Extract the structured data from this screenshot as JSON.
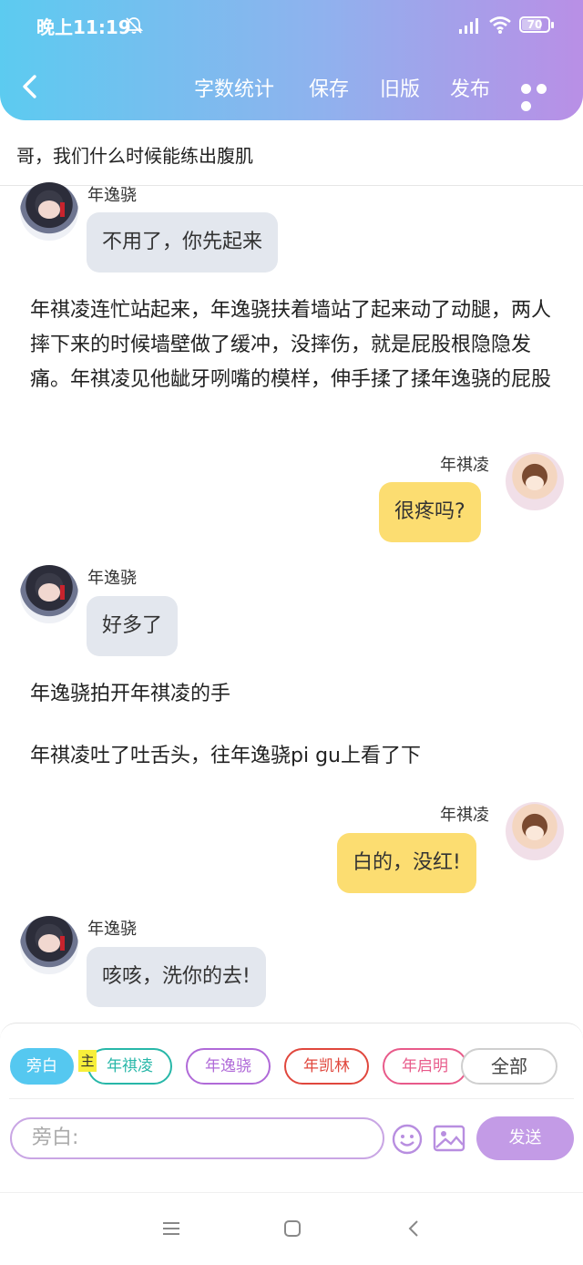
{
  "status_bar": {
    "time": "晚上11:19",
    "battery": "70"
  },
  "header": {
    "actions": [
      "字数统计",
      "保存",
      "旧版",
      "发布"
    ]
  },
  "chapter_title": "哥，我们什么时候能练出腹肌",
  "messages": [
    {
      "type": "left",
      "name": "年逸骁",
      "text": "不用了，你先起来"
    },
    {
      "type": "narration",
      "text": "年祺凌连忙站起来，年逸骁扶着墙站了起来动了动腿，两人摔下来的时候墙壁做了缓冲，没摔伤，就是屁股根隐隐发痛。年祺凌见他龇牙咧嘴的模样，伸手揉了揉年逸骁的屁股"
    },
    {
      "type": "right",
      "name": "年祺凌",
      "text": "很疼吗?"
    },
    {
      "type": "left",
      "name": "年逸骁",
      "text": "好多了"
    },
    {
      "type": "narration",
      "text": "年逸骁拍开年祺凌的手"
    },
    {
      "type": "narration",
      "text": "年祺凌吐了吐舌头，往年逸骁pi gu上看了下"
    },
    {
      "type": "right",
      "name": "年祺凌",
      "text": "白的，没红!"
    },
    {
      "type": "left",
      "name": "年逸骁",
      "text": "咳咳，洗你的去!"
    }
  ],
  "character_bar": {
    "selected": "旁白",
    "main_tag": "主",
    "characters": [
      "年祺凌",
      "年逸骁",
      "年凯林",
      "年启明"
    ],
    "all_label": "全部"
  },
  "composer": {
    "placeholder": "旁白:",
    "send_label": "发送"
  },
  "colors": {
    "header_start": "#5ccbf0",
    "header_end": "#b98fe6",
    "bubble_self": "#fcdd71",
    "bubble_other": "#e3e7ee",
    "send": "#c39be6"
  }
}
